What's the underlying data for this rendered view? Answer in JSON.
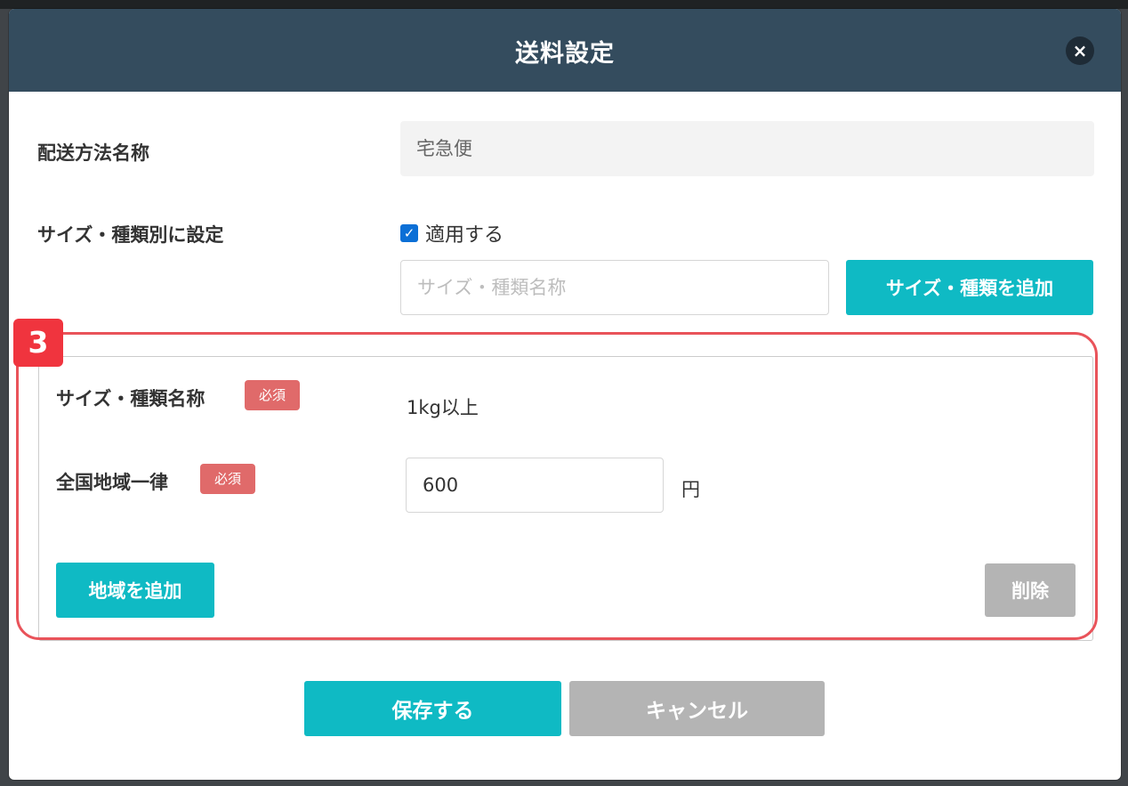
{
  "modal": {
    "title": "送料設定",
    "close_label": "×"
  },
  "shipping_method": {
    "label": "配送方法名称",
    "value": "宅急便"
  },
  "size_type": {
    "label": "サイズ・種類別に設定",
    "checkbox_checked": true,
    "checkbox_label": "適用する",
    "name_placeholder": "サイズ・種類名称",
    "add_button": "サイズ・種類を追加"
  },
  "annotation": {
    "step_number": "3"
  },
  "size_entry": {
    "name_label": "サイズ・種類名称",
    "name_required": "必須",
    "name_value": "1kg以上",
    "nationwide_label": "全国地域一律",
    "nationwide_required": "必須",
    "nationwide_value": "600",
    "currency_unit": "円",
    "add_region_button": "地域を追加",
    "delete_button": "削除"
  },
  "footer": {
    "save_button": "保存する",
    "cancel_button": "キャンセル"
  },
  "colors": {
    "header_bg": "#344c5e",
    "accent_teal": "#0fbac4",
    "highlight_red": "#e9535a",
    "required_badge": "#e06a6a",
    "disabled_gray": "#b4b4b4"
  }
}
